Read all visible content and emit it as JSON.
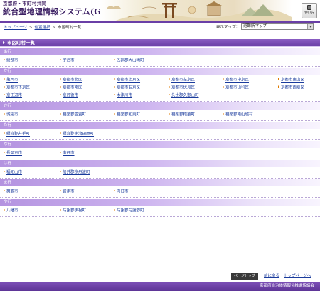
{
  "header": {
    "org": "京都府・市町村共同",
    "system_title": "統合型地理情報システム(GIS)",
    "usage_label": "使い方"
  },
  "breadcrumb": [
    "トップページ",
    "位置選択",
    "市区町村一覧"
  ],
  "map_selector": {
    "label": "表示マップ：",
    "selected": "避難所マップ"
  },
  "page_title": "市区町村一覧",
  "sections": [
    {
      "heading": "あ行",
      "rows": [
        [
          "綾部市",
          "宇治市",
          "乙訓郡大山崎町"
        ]
      ]
    },
    {
      "heading": "か行",
      "rows": [
        [
          "亀岡市",
          "京都市北区",
          "京都市上京区",
          "京都市左京区",
          "京都市中京区",
          "京都市東山区"
        ],
        [
          "京都市下京区",
          "京都市南区",
          "京都市右京区",
          "京都市伏見区",
          "京都市山科区",
          "京都市西京区"
        ],
        [
          "京田辺市",
          "京丹後市",
          "木津川市",
          "久世郡久御山町"
        ]
      ]
    },
    {
      "heading": "さ行",
      "rows": [
        [
          "城陽市",
          "相楽郡笠置町",
          "相楽郡和束町",
          "相楽郡精華町",
          "相楽郡南山城村"
        ]
      ]
    },
    {
      "heading": "た行",
      "rows": [
        [
          "綴喜郡井手町",
          "綴喜郡宇治田原町"
        ]
      ]
    },
    {
      "heading": "な行",
      "rows": [
        [
          "長岡京市",
          "南丹市"
        ]
      ]
    },
    {
      "heading": "は行",
      "rows": [
        [
          "福知山市",
          "船井郡京丹波町"
        ]
      ]
    },
    {
      "heading": "ま行",
      "rows": [
        [
          "舞鶴市",
          "宮津市",
          "向日市"
        ]
      ]
    },
    {
      "heading": "や行",
      "rows": [
        [
          "八幡市",
          "与謝郡伊根町",
          "与謝郡与謝野町"
        ]
      ]
    }
  ],
  "footer_nav": {
    "page_top": "ページトップ",
    "back": "前に戻る",
    "top_page": "トップページへ"
  },
  "footer": {
    "text": "京都府自治体情報化推進協議会"
  },
  "colors": {
    "brand_purple": "#6a3fa6",
    "link": "#1a3b9c",
    "bullet": "#e07a00"
  }
}
